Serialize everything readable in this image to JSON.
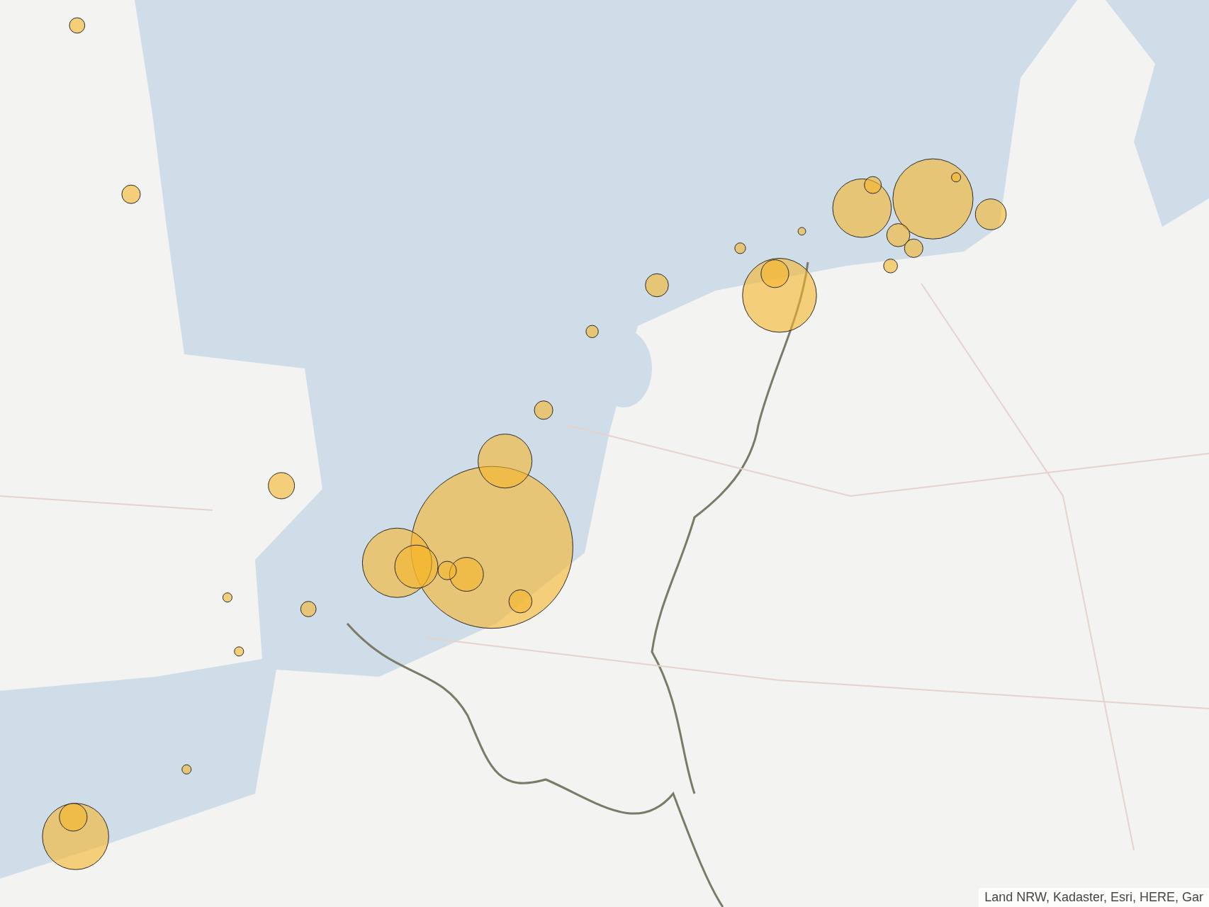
{
  "attribution": "Land NRW, Kadaster, Esri, HERE, Gar"
}
